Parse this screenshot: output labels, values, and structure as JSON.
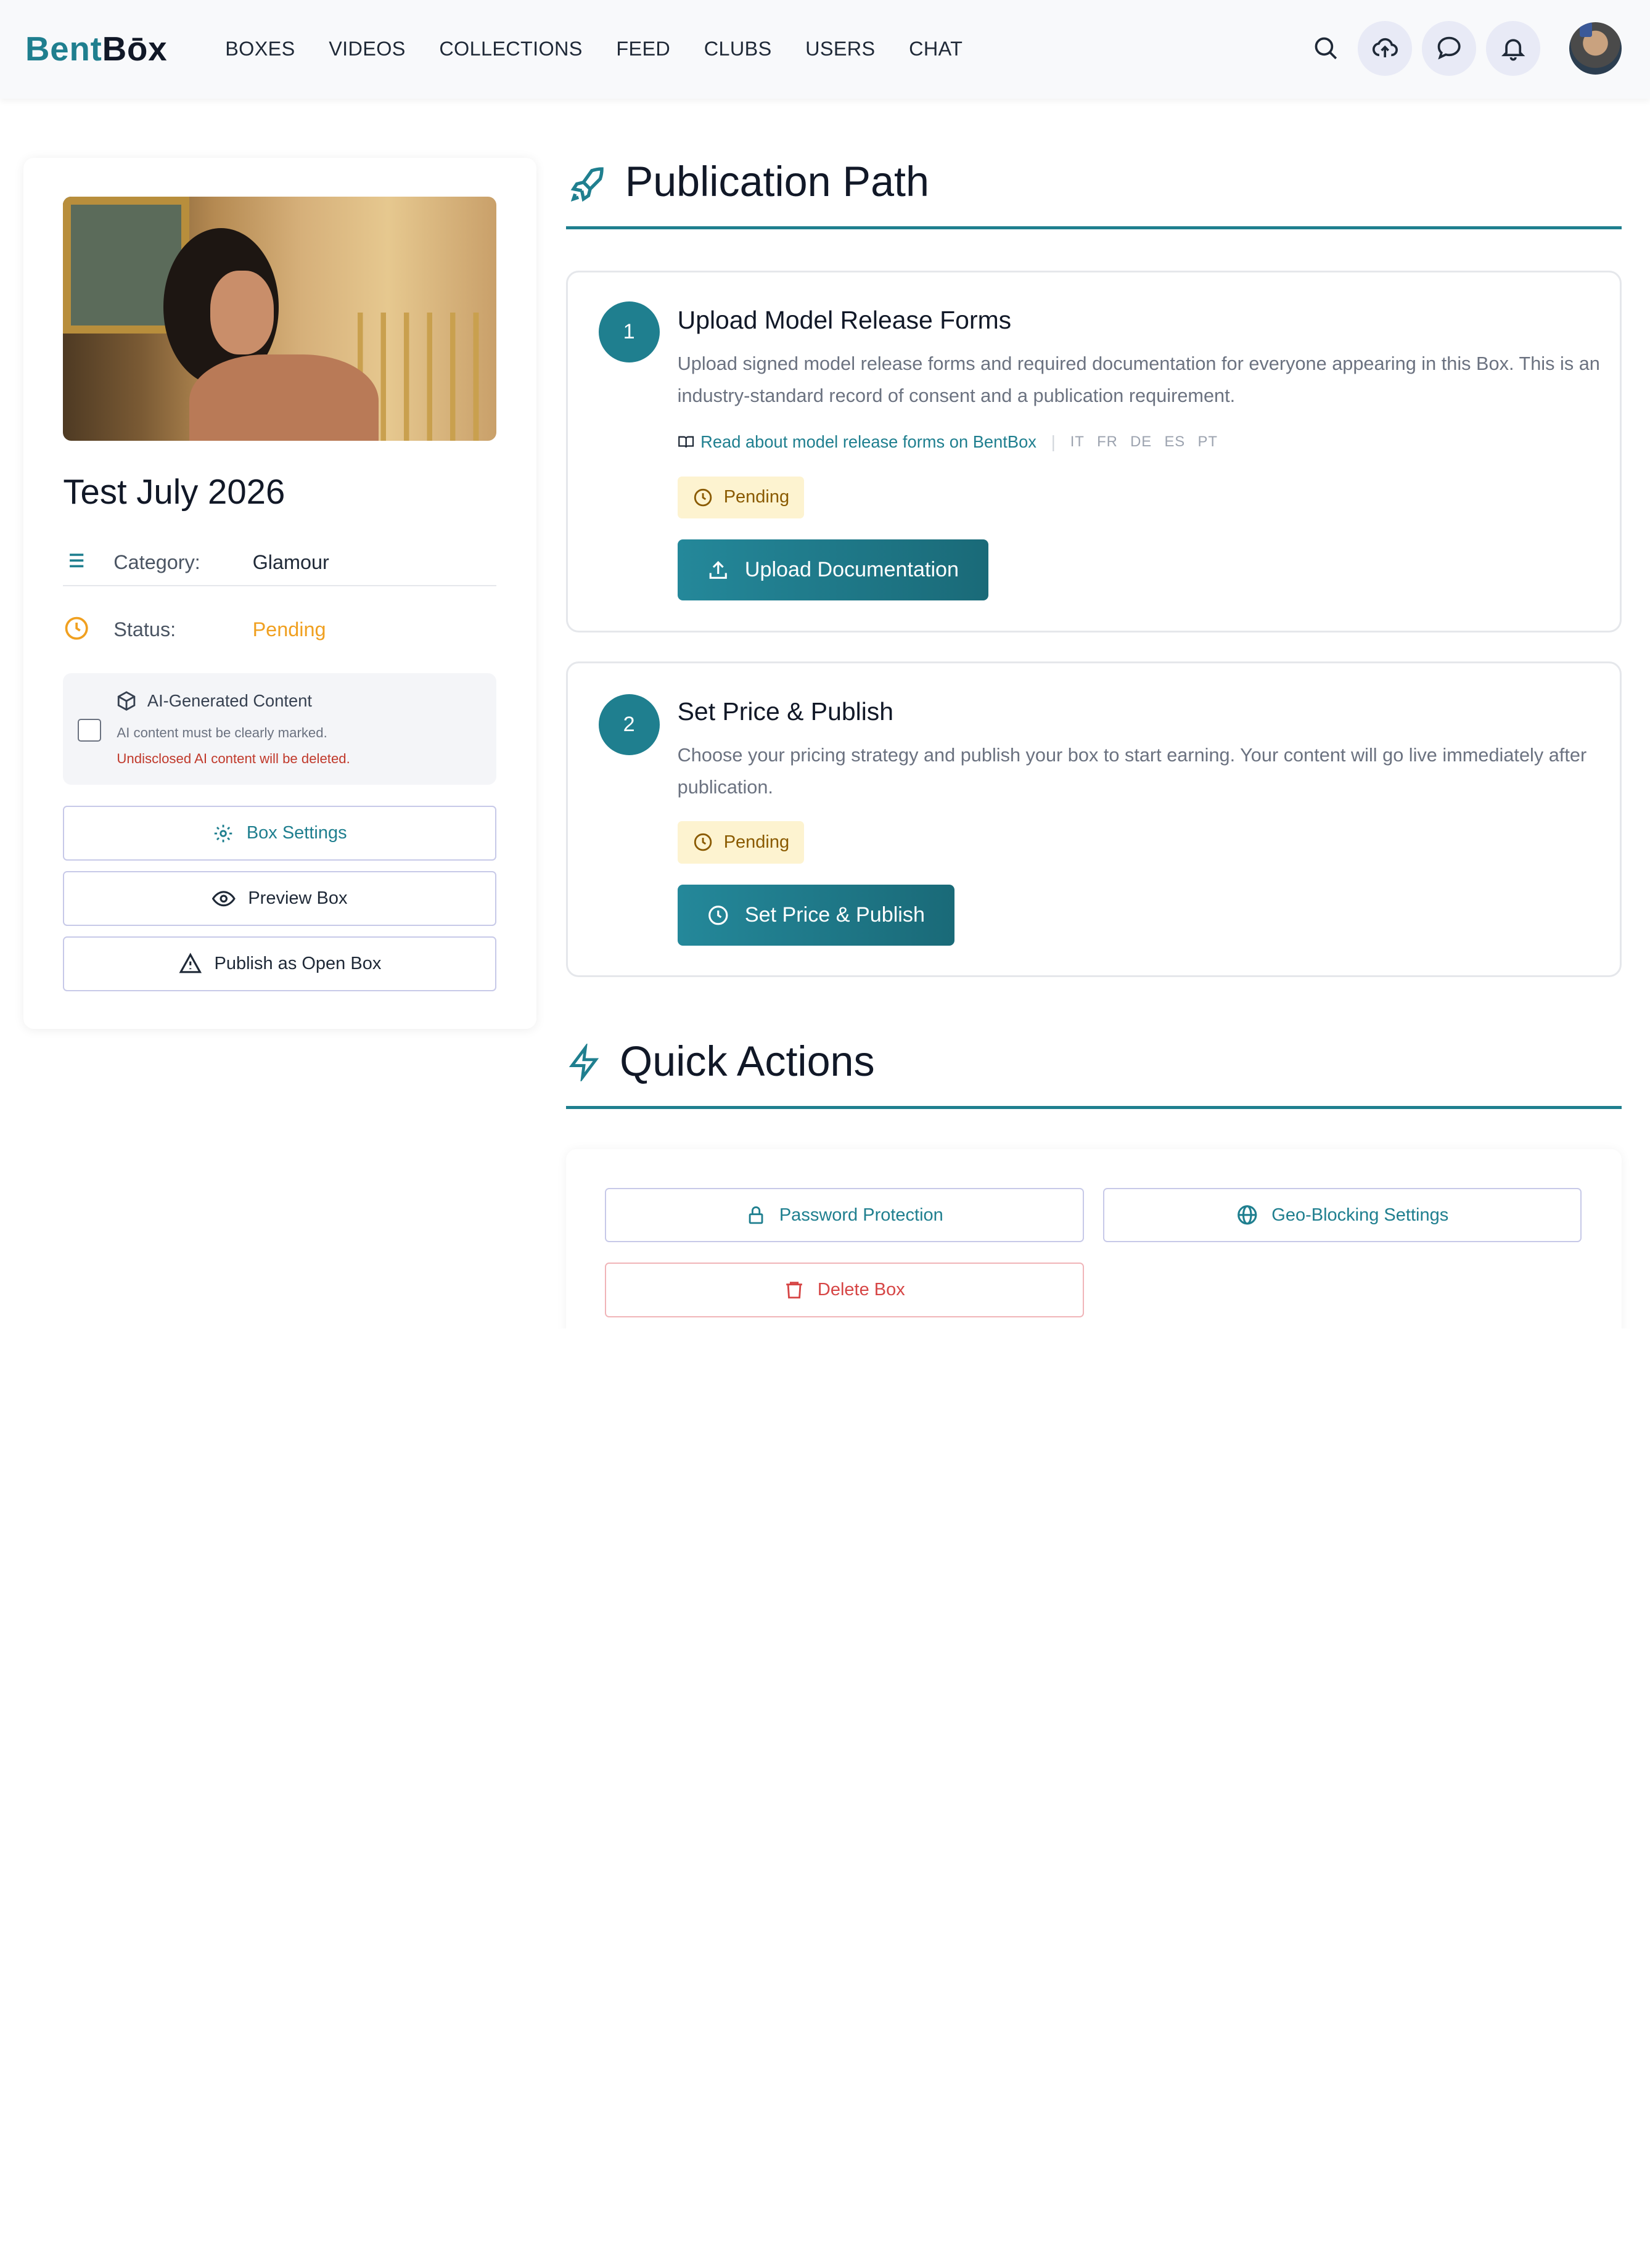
{
  "nav": {
    "logo_part1": "Bent",
    "logo_part2": "Bōx",
    "menu": [
      "BOXES",
      "VIDEOS",
      "COLLECTIONS",
      "FEED",
      "CLUBS",
      "USERS",
      "CHAT"
    ],
    "icons": [
      "search-icon",
      "upload-cloud-icon",
      "chat-icon",
      "bell-icon"
    ]
  },
  "box": {
    "title": "Test July 2026",
    "category_label": "Category:",
    "category_value": "Glamour",
    "status_label": "Status:",
    "status_value": "Pending",
    "ai": {
      "title": "AI-Generated Content",
      "line1": "AI content must be clearly marked.",
      "line2": "Undisclosed AI content will be deleted."
    },
    "buttons": {
      "settings": "Box Settings",
      "preview": "Preview Box",
      "open": "Publish as Open Box"
    }
  },
  "publication": {
    "heading": "Publication Path",
    "steps": [
      {
        "number": "1",
        "title": "Upload Model Release Forms",
        "desc": "Upload signed model release forms and required documentation for everyone appearing in this Box. This is an industry-standard record of consent and a publication requirement.",
        "link": "Read about model release forms on BentBox",
        "languages": [
          "IT",
          "FR",
          "DE",
          "ES",
          "PT"
        ],
        "status": "Pending",
        "button": "Upload Documentation"
      },
      {
        "number": "2",
        "title": "Set Price & Publish",
        "desc": "Choose your pricing strategy and publish your box to start earning. Your content will go live immediately after publication.",
        "status": "Pending",
        "button": "Set Price & Publish"
      }
    ]
  },
  "quick_actions": {
    "heading": "Quick Actions",
    "password": "Password Protection",
    "geo": "Geo-Blocking Settings",
    "delete": "Delete Box"
  },
  "colors": {
    "accent": "#1f7f8f",
    "pending": "#f0a020",
    "danger": "#d64545"
  }
}
